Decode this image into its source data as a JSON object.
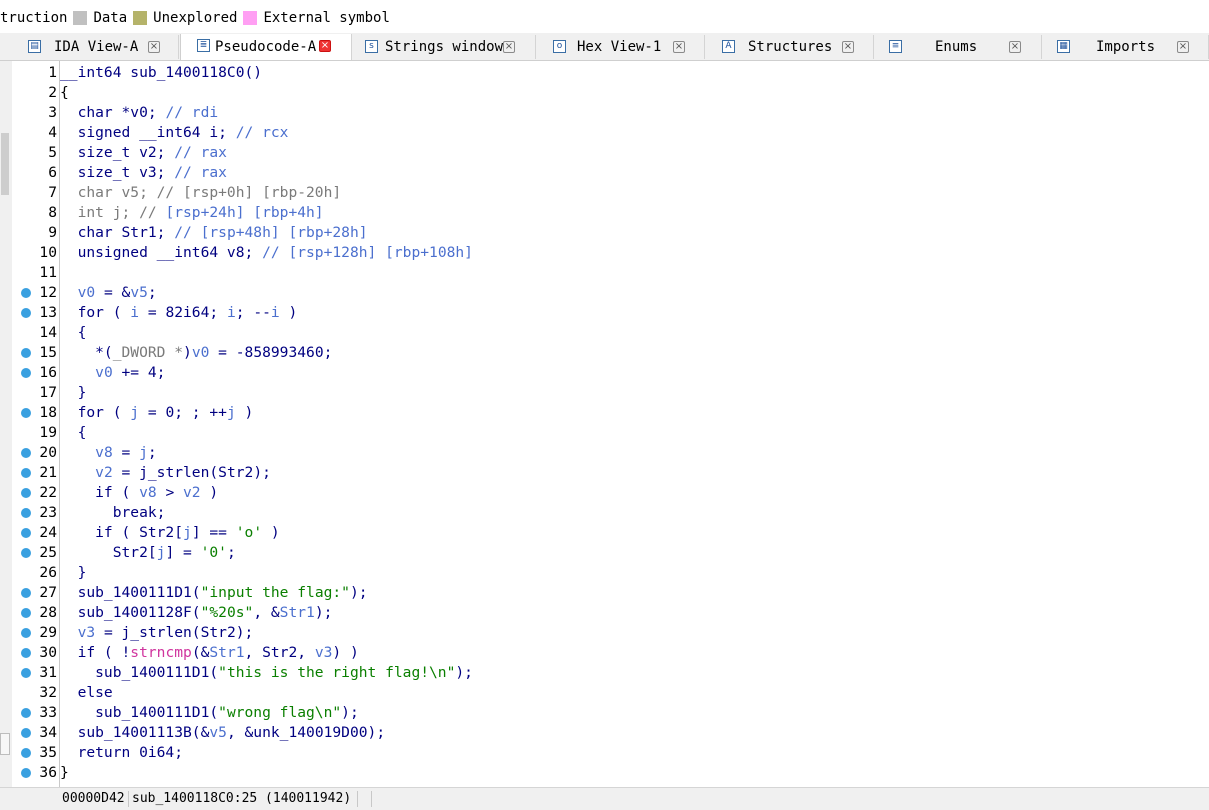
{
  "legend": [
    {
      "label": "truction",
      "color": ""
    },
    {
      "label": "Data",
      "color": "#c0c0c0"
    },
    {
      "label": "Unexplored",
      "color": "#b5b36a"
    },
    {
      "label": "External symbol",
      "color": "#ff9ff3"
    }
  ],
  "tabs": [
    {
      "label": "IDA View-A",
      "icon": "ida-view-icon",
      "glyph": "▤",
      "active": false,
      "close": "×"
    },
    {
      "label": "Pseudocode-A",
      "icon": "pseudocode-icon",
      "glyph": "≣",
      "active": true,
      "close": "×"
    },
    {
      "label": "Strings window",
      "icon": "strings-icon",
      "glyph": "s",
      "active": false,
      "close": "×"
    },
    {
      "label": "Hex View-1",
      "icon": "hex-view-icon",
      "glyph": "o",
      "active": false,
      "close": "×"
    },
    {
      "label": "Structures",
      "icon": "structures-icon",
      "glyph": "A",
      "active": false,
      "close": "×"
    },
    {
      "label": "Enums",
      "icon": "enums-icon",
      "glyph": "≡",
      "active": false,
      "close": "×"
    },
    {
      "label": "Imports",
      "icon": "imports-icon",
      "glyph": "▦",
      "active": false,
      "close": "×"
    }
  ],
  "code_lines": [
    {
      "n": "1",
      "bp": false,
      "t": [
        [
          "__int64 sub_1400118C0()",
          "kw"
        ]
      ]
    },
    {
      "n": "2",
      "bp": false,
      "t": [
        [
          "{",
          ""
        ]
      ]
    },
    {
      "n": "3",
      "bp": false,
      "t": [
        [
          "  char *v0; ",
          "kw"
        ],
        [
          "// rdi",
          "cm"
        ]
      ]
    },
    {
      "n": "4",
      "bp": false,
      "t": [
        [
          "  signed __int64 i; ",
          "kw"
        ],
        [
          "// rcx",
          "cm"
        ]
      ]
    },
    {
      "n": "5",
      "bp": false,
      "t": [
        [
          "  size_t v2; ",
          "kw"
        ],
        [
          "// rax",
          "cm"
        ]
      ]
    },
    {
      "n": "6",
      "bp": false,
      "t": [
        [
          "  size_t v3; ",
          "kw"
        ],
        [
          "// rax",
          "cm"
        ]
      ]
    },
    {
      "n": "7",
      "bp": false,
      "t": [
        [
          "  char v5; // [rsp+0h] [rbp-20h]",
          "gray"
        ]
      ]
    },
    {
      "n": "8",
      "bp": false,
      "t": [
        [
          "  int j; // ",
          "gray"
        ],
        [
          "[rsp+24h] [rbp+4h]",
          "cm"
        ]
      ]
    },
    {
      "n": "9",
      "bp": false,
      "t": [
        [
          "  char Str1; ",
          "kw"
        ],
        [
          "// [rsp+48h] [rbp+28h]",
          "cm"
        ]
      ]
    },
    {
      "n": "10",
      "bp": false,
      "t": [
        [
          "  unsigned __int64 v8; ",
          "kw"
        ],
        [
          "// [rsp+128h] [rbp+108h]",
          "cm"
        ]
      ]
    },
    {
      "n": "11",
      "bp": false,
      "t": [
        [
          "",
          ""
        ]
      ]
    },
    {
      "n": "12",
      "bp": true,
      "t": [
        [
          "  v0",
          "var"
        ],
        [
          " = &",
          "kw"
        ],
        [
          "v5",
          "var"
        ],
        [
          ";",
          "kw"
        ]
      ]
    },
    {
      "n": "13",
      "bp": true,
      "t": [
        [
          "  for ( ",
          "kw"
        ],
        [
          "i",
          "var"
        ],
        [
          " = 82i64; ",
          "kw"
        ],
        [
          "i",
          "var"
        ],
        [
          "; --",
          "kw"
        ],
        [
          "i",
          "var"
        ],
        [
          " )",
          "kw"
        ]
      ]
    },
    {
      "n": "14",
      "bp": false,
      "t": [
        [
          "  {",
          "kw"
        ]
      ]
    },
    {
      "n": "15",
      "bp": true,
      "t": [
        [
          "    *(",
          "kw"
        ],
        [
          "_DWORD *",
          "gray"
        ],
        [
          ")",
          "kw"
        ],
        [
          "v0",
          "var"
        ],
        [
          " = -858993460;",
          "kw"
        ]
      ]
    },
    {
      "n": "16",
      "bp": true,
      "t": [
        [
          "    ",
          ""
        ],
        [
          "v0",
          "var"
        ],
        [
          " += 4;",
          "kw"
        ]
      ]
    },
    {
      "n": "17",
      "bp": false,
      "t": [
        [
          "  }",
          "kw"
        ]
      ]
    },
    {
      "n": "18",
      "bp": true,
      "t": [
        [
          "  for ( ",
          "kw"
        ],
        [
          "j",
          "var"
        ],
        [
          " = 0; ; ++",
          "kw"
        ],
        [
          "j",
          "var"
        ],
        [
          " )",
          "kw"
        ]
      ]
    },
    {
      "n": "19",
      "bp": false,
      "t": [
        [
          "  {",
          "kw"
        ]
      ]
    },
    {
      "n": "20",
      "bp": true,
      "t": [
        [
          "    ",
          ""
        ],
        [
          "v8",
          "var"
        ],
        [
          " = ",
          "kw"
        ],
        [
          "j",
          "var"
        ],
        [
          ";",
          "kw"
        ]
      ]
    },
    {
      "n": "21",
      "bp": true,
      "t": [
        [
          "    ",
          ""
        ],
        [
          "v2",
          "var"
        ],
        [
          " = j_strlen(Str2);",
          "kw"
        ]
      ]
    },
    {
      "n": "22",
      "bp": true,
      "t": [
        [
          "    if ( ",
          "kw"
        ],
        [
          "v8",
          "var"
        ],
        [
          " > ",
          "kw"
        ],
        [
          "v2",
          "var"
        ],
        [
          " )",
          "kw"
        ]
      ]
    },
    {
      "n": "23",
      "bp": true,
      "t": [
        [
          "      break;",
          "kw"
        ]
      ]
    },
    {
      "n": "24",
      "bp": true,
      "t": [
        [
          "    if ( Str2[",
          "kw"
        ],
        [
          "j",
          "var"
        ],
        [
          "] == ",
          "kw"
        ],
        [
          "'o'",
          "str"
        ],
        [
          " )",
          "kw"
        ]
      ]
    },
    {
      "n": "25",
      "bp": true,
      "t": [
        [
          "      Str2[",
          "kw"
        ],
        [
          "j",
          "var"
        ],
        [
          "] = ",
          "kw"
        ],
        [
          "'0'",
          "str"
        ],
        [
          ";",
          "kw"
        ]
      ]
    },
    {
      "n": "26",
      "bp": false,
      "t": [
        [
          "  }",
          "kw"
        ]
      ]
    },
    {
      "n": "27",
      "bp": true,
      "t": [
        [
          "  sub_1400111D1(",
          "kw"
        ],
        [
          "\"input the flag:\"",
          "str"
        ],
        [
          ");",
          "kw"
        ]
      ]
    },
    {
      "n": "28",
      "bp": true,
      "t": [
        [
          "  sub_14001128F(",
          "kw"
        ],
        [
          "\"%20s\"",
          "str"
        ],
        [
          ", &",
          "kw"
        ],
        [
          "Str1",
          "var"
        ],
        [
          ");",
          "kw"
        ]
      ]
    },
    {
      "n": "29",
      "bp": true,
      "t": [
        [
          "  ",
          ""
        ],
        [
          "v3",
          "var"
        ],
        [
          " = j_strlen(Str2);",
          "kw"
        ]
      ]
    },
    {
      "n": "30",
      "bp": true,
      "t": [
        [
          "  if ( !",
          "kw"
        ],
        [
          "strncmp",
          "lib"
        ],
        [
          "(&",
          "kw"
        ],
        [
          "Str1",
          "var"
        ],
        [
          ", Str2, ",
          "kw"
        ],
        [
          "v3",
          "var"
        ],
        [
          ") )",
          "kw"
        ]
      ]
    },
    {
      "n": "31",
      "bp": true,
      "t": [
        [
          "    sub_1400111D1(",
          "kw"
        ],
        [
          "\"this is the right flag!\\n\"",
          "str"
        ],
        [
          ");",
          "kw"
        ]
      ]
    },
    {
      "n": "32",
      "bp": false,
      "t": [
        [
          "  else",
          "kw"
        ]
      ]
    },
    {
      "n": "33",
      "bp": true,
      "t": [
        [
          "    sub_1400111D1(",
          "kw"
        ],
        [
          "\"wrong flag\\n\"",
          "str"
        ],
        [
          ");",
          "kw"
        ]
      ]
    },
    {
      "n": "34",
      "bp": true,
      "t": [
        [
          "  sub_14001113B(&",
          "kw"
        ],
        [
          "v5",
          "var"
        ],
        [
          ", &unk_140019D00);",
          "kw"
        ]
      ]
    },
    {
      "n": "35",
      "bp": true,
      "t": [
        [
          "  return 0i64;",
          "kw"
        ]
      ]
    },
    {
      "n": "36",
      "bp": true,
      "t": [
        [
          "}",
          ""
        ]
      ]
    }
  ],
  "status": {
    "address": "00000D42",
    "location": "sub_1400118C0:25 (140011942)"
  }
}
